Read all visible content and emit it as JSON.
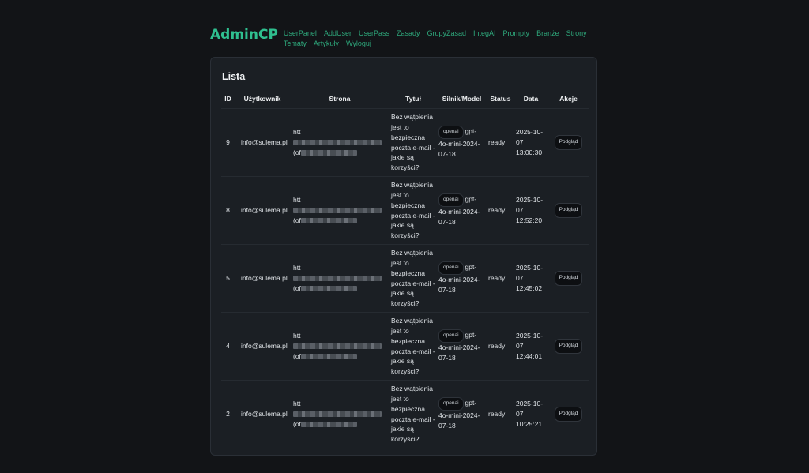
{
  "header": {
    "logo": "AdminCP",
    "nav": [
      "UserPanel",
      "AddUser",
      "UserPass",
      "Zasady",
      "GrupyZasad",
      "IntegAI",
      "Prompty",
      "Branże",
      "Strony",
      "Tematy",
      "Artykuły",
      "Wyloguj"
    ]
  },
  "list": {
    "title": "Lista",
    "columns": [
      "ID",
      "Użytkownik",
      "Strona",
      "Tytuł",
      "Silnik/Model",
      "Status",
      "Data",
      "Akcje"
    ],
    "rows": [
      {
        "id": "9",
        "user": "info@sulema.pl",
        "url_start": "htt",
        "url_start2": "(of",
        "title": "Bez wątpienia jest to bezpieczna poczta e-mail - jakie są korzyści?",
        "engine": "openai",
        "model": "gpt-4o-mini-2024-07-18",
        "status": "ready",
        "date": "2025-10-07 13:00:30",
        "action": "Podgląd"
      },
      {
        "id": "8",
        "user": "info@sulema.pl",
        "url_start": "htt",
        "url_start2": "(of",
        "title": "Bez wątpienia jest to bezpieczna poczta e-mail - jakie są korzyści?",
        "engine": "openai",
        "model": "gpt-4o-mini-2024-07-18",
        "status": "ready",
        "date": "2025-10-07 12:52:20",
        "action": "Podgląd"
      },
      {
        "id": "5",
        "user": "info@sulema.pl",
        "url_start": "htt",
        "url_start2": "(of",
        "title": "Bez wątpienia jest to bezpieczna poczta e-mail - jakie są korzyści?",
        "engine": "openai",
        "model": "gpt-4o-mini-2024-07-18",
        "status": "ready",
        "date": "2025-10-07 12:45:02",
        "action": "Podgląd"
      },
      {
        "id": "4",
        "user": "info@sulema.pl",
        "url_start": "htt",
        "url_start2": "(of",
        "title": "Bez wątpienia jest to bezpieczna poczta e-mail - jakie są korzyści?",
        "engine": "openai",
        "model": "gpt-4o-mini-2024-07-18",
        "status": "ready",
        "date": "2025-10-07 12:44:01",
        "action": "Podgląd"
      },
      {
        "id": "2",
        "user": "info@sulema.pl",
        "url_start": "htt",
        "url_start2": "(of",
        "title": "Bez wątpienia jest to bezpieczna poczta e-mail - jakie są korzyści?",
        "engine": "openai",
        "model": "gpt-4o-mini-2024-07-18",
        "status": "ready",
        "date": "2025-10-07 10:25:21",
        "action": "Podgląd"
      }
    ]
  }
}
